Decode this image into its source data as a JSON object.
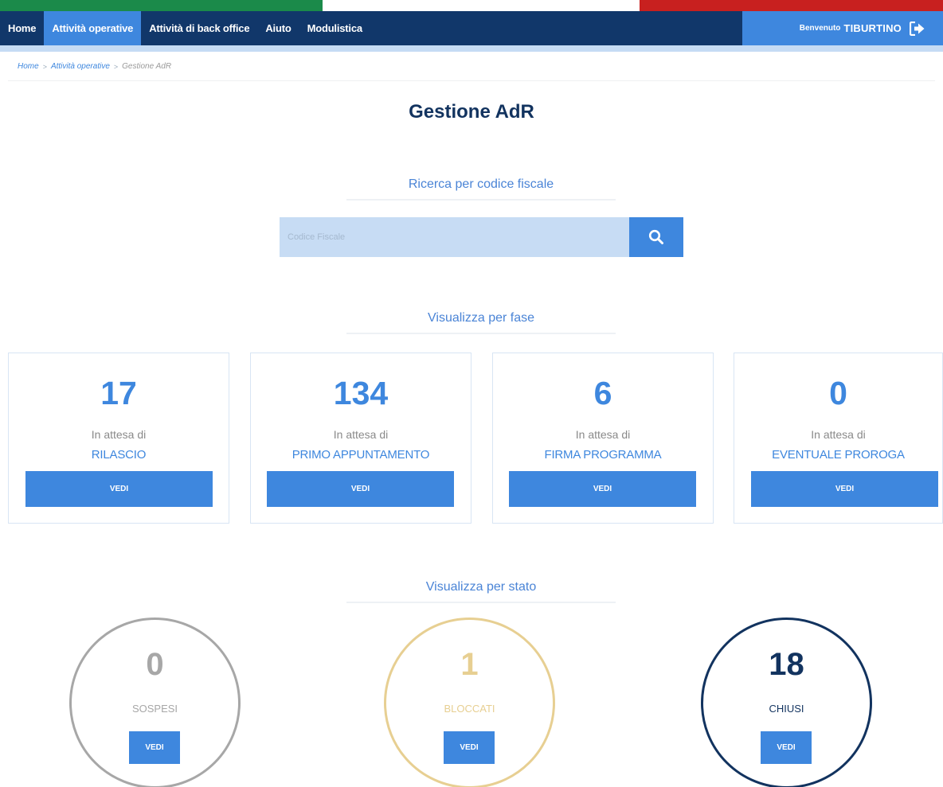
{
  "flag_colors": [
    "#1b8a4a",
    "#ffffff",
    "#c8201f"
  ],
  "nav": {
    "items": [
      {
        "label": "Home"
      },
      {
        "label": "Attività operative"
      },
      {
        "label": "Attività di back office"
      },
      {
        "label": "Aiuto"
      },
      {
        "label": "Modulistica"
      }
    ],
    "welcome_label": "Benvenuto",
    "user_name": "TIBURTINO",
    "logout_icon": "sign-out-icon"
  },
  "breadcrumb": {
    "items": [
      "Home",
      "Attività operative"
    ],
    "separator": ">",
    "current": "Gestione AdR"
  },
  "page_title": "Gestione AdR",
  "search": {
    "heading": "Ricerca per codice fiscale",
    "placeholder": "Codice Fiscale",
    "value": "",
    "button_icon": "search-icon"
  },
  "phases": {
    "heading": "Visualizza per fase",
    "cards": [
      {
        "count": "17",
        "waiting": "In attesa di",
        "phase": "RILASCIO",
        "button": "VEDI"
      },
      {
        "count": "134",
        "waiting": "In attesa di",
        "phase": "PRIMO APPUNTAMENTO",
        "button": "VEDI"
      },
      {
        "count": "6",
        "waiting": "In attesa di",
        "phase": "FIRMA PROGRAMMA",
        "button": "VEDI"
      },
      {
        "count": "0",
        "waiting": "In attesa di",
        "phase": "EVENTUALE PROROGA",
        "button": "VEDI"
      }
    ]
  },
  "states": {
    "heading": "Visualizza per stato",
    "items": [
      {
        "count": "0",
        "label": "SOSPESI",
        "button": "VEDI",
        "color": "#a7a7a7"
      },
      {
        "count": "1",
        "label": "BLOCCATI",
        "button": "VEDI",
        "color": "#e7cf92"
      },
      {
        "count": "18",
        "label": "CHIUSI",
        "button": "VEDI",
        "color": "#12335f"
      }
    ]
  },
  "colors": {
    "navbar": "#11376a",
    "accent": "#3e87de",
    "title": "#12335f"
  }
}
